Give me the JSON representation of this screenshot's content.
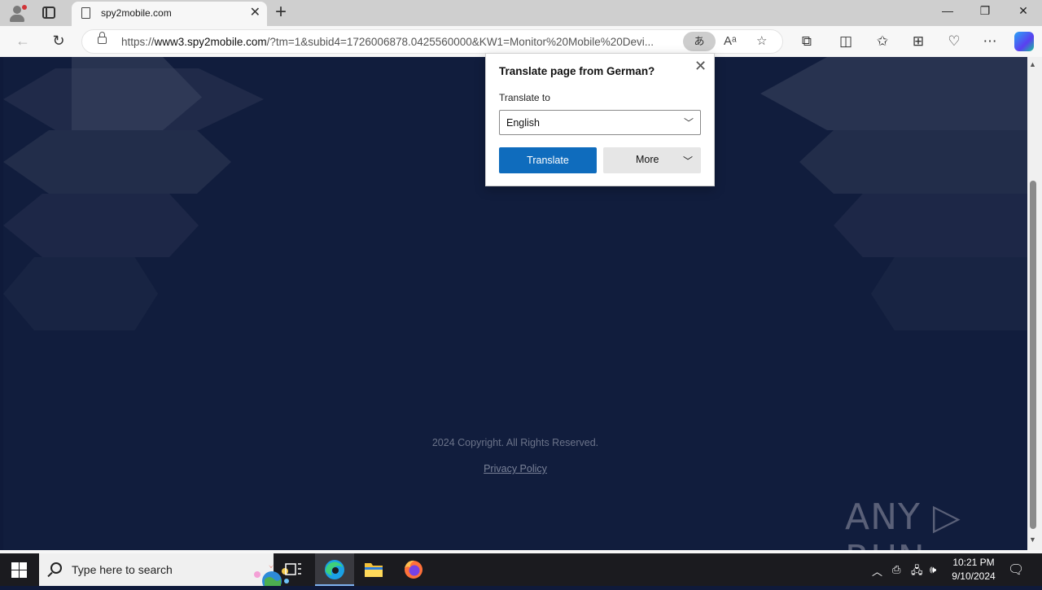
{
  "browser": {
    "tab": {
      "title": "spy2mobile.com",
      "close_glyph": "✕"
    },
    "new_tab_glyph": "+",
    "window_controls": {
      "minimize": "—",
      "restore": "❐",
      "close": "✕"
    },
    "address": {
      "scheme": "https://",
      "host": "www3.spy2mobile.com",
      "path": "/?tm=1&subid4=1726006878.0425560000&KW1=Monitor%20Mobile%20Devi...",
      "translate_glyph": "あ"
    },
    "toolbar_icons": [
      "back-icon",
      "refresh-icon",
      "read-aloud-icon",
      "favorite-icon",
      "extensions-icon",
      "split-screen-icon",
      "favorites-icon",
      "collections-icon",
      "browser-essentials-icon",
      "more-icon",
      "copilot-icon"
    ]
  },
  "translate_popup": {
    "title": "Translate page from German?",
    "translate_to_label": "Translate to",
    "selected_language": "English",
    "translate_button": "Translate",
    "more_button": "More"
  },
  "page": {
    "copyright": "2024 Copyright. All Rights Reserved.",
    "privacy_link": "Privacy Policy",
    "watermark": "ANY ▷ RUN"
  },
  "taskbar": {
    "search_placeholder": "Type here to search",
    "time": "10:21 PM",
    "date": "9/10/2024",
    "apps": [
      "task-view-icon",
      "edge-icon",
      "file-explorer-icon",
      "firefox-icon"
    ]
  },
  "colors": {
    "page_bg": "#111d3d",
    "translate_button_bg": "#0f6cbd",
    "taskbar_bg": "#1b1b1f"
  }
}
